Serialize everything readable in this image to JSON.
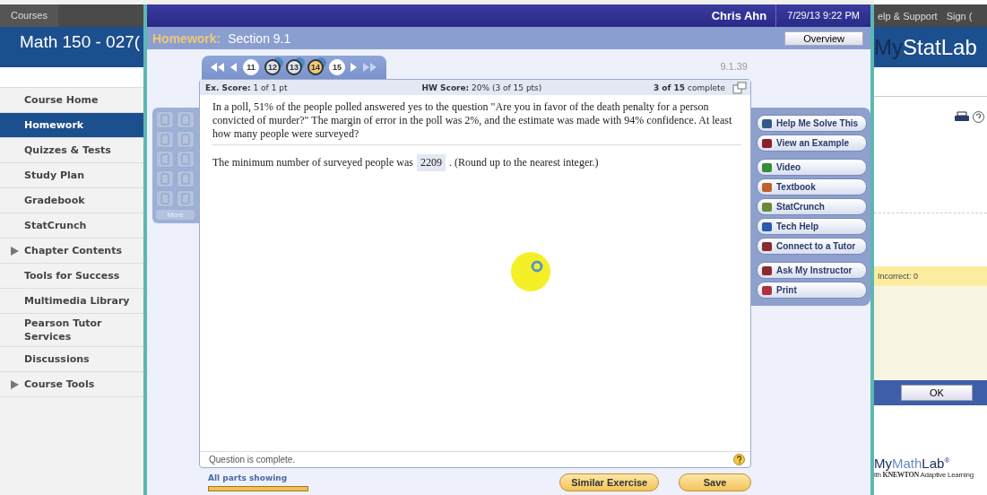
{
  "left_page": {
    "courses_tab": "Courses",
    "course_title": "Math 150 - 027(",
    "nav": [
      {
        "label": "Course Home",
        "selected": false,
        "expandable": false
      },
      {
        "label": "Homework",
        "selected": true,
        "expandable": false
      },
      {
        "label": "Quizzes & Tests",
        "selected": false,
        "expandable": false
      },
      {
        "label": "Study Plan",
        "selected": false,
        "expandable": false
      },
      {
        "label": "Gradebook",
        "selected": false,
        "expandable": false
      },
      {
        "label": "StatCrunch",
        "selected": false,
        "expandable": false
      },
      {
        "label": "Chapter Contents",
        "selected": false,
        "expandable": true
      },
      {
        "label": "Tools for Success",
        "selected": false,
        "expandable": false
      },
      {
        "label": "Multimedia Library",
        "selected": false,
        "expandable": false
      },
      {
        "label": "Pearson Tutor Services",
        "selected": false,
        "expandable": false
      },
      {
        "label": "Discussions",
        "selected": false,
        "expandable": false
      },
      {
        "label": "Course Tools",
        "selected": false,
        "expandable": true
      }
    ]
  },
  "window": {
    "user": "Chris Ahn",
    "datetime": "7/29/13 9:22 PM",
    "title_label": "Homework:",
    "title": "Section 9.1",
    "overview_button": "Overview"
  },
  "question_nav": {
    "questions": [
      {
        "label": "11",
        "completed": false,
        "selected": false
      },
      {
        "label": "12",
        "completed": true,
        "selected": false
      },
      {
        "label": "13",
        "completed": true,
        "selected": false
      },
      {
        "label": "14",
        "completed": true,
        "selected": true
      },
      {
        "label": "15",
        "completed": false,
        "selected": false
      }
    ],
    "question_id": "9.1.39"
  },
  "palette": {
    "more_button": "More"
  },
  "question": {
    "ex_score_label": "Ex. Score:",
    "ex_score": "1 of 1 pt",
    "hw_score_label": "HW Score:",
    "hw_score": "20% (3 of 15 pts)",
    "progress_count": "3 of 15",
    "progress_label": "complete",
    "text": "In a poll, 51% of the people polled answered yes to the question \"Are you in favor of the death penalty for a person convicted of murder?\" The margin of error in the poll was 2%, and the estimate was made with 94% confidence. At least how many people were surveyed?",
    "answer_prefix": "The minimum number of surveyed people was",
    "answer": "2209",
    "answer_suffix": ". (Round up to the nearest integer.)",
    "status": "Question is complete."
  },
  "help_groups": [
    [
      {
        "label": "Help Me Solve This"
      },
      {
        "label": "View an Example"
      }
    ],
    [
      {
        "label": "Video"
      },
      {
        "label": "Textbook"
      },
      {
        "label": "StatCrunch"
      },
      {
        "label": "Tech Help"
      },
      {
        "label": "Connect to a Tutor"
      }
    ],
    [
      {
        "label": "Ask My Instructor"
      },
      {
        "label": "Print"
      }
    ]
  ],
  "footer": {
    "parts_label": "All parts showing",
    "similar_button": "Similar Exercise",
    "save_button": "Save"
  },
  "right_page": {
    "help_link": "elp & Support",
    "sign_link": "Sign (",
    "brand_dark": "My",
    "brand_light": "StatLab",
    "incorrect": "Incorrect: 0",
    "ok_button": "OK",
    "logo_a": "My",
    "logo_b": "Math",
    "logo_c": "Lab",
    "logo_mark": "®",
    "logo_tagline_a": "ith",
    "logo_tagline_b": "KNEWTON",
    "logo_tagline_c": "Adaptive Learning"
  }
}
